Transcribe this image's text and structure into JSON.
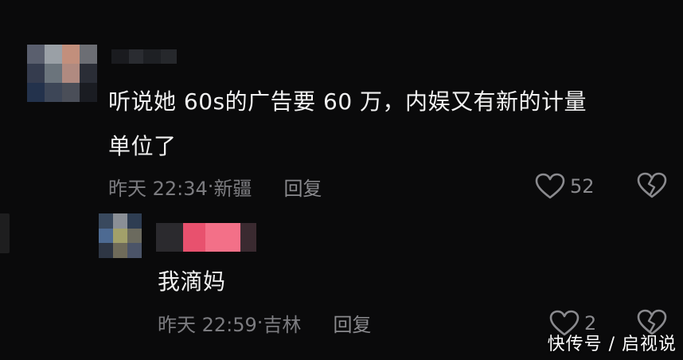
{
  "comments": [
    {
      "text_line1": "听说她 60s的广告要 60 万，内娱又有新的计量",
      "text_line2": "单位了",
      "time": "昨天 22:34",
      "separator": "·",
      "location": "新疆",
      "reply_label": "回复",
      "like_count": "52",
      "avatar_colors": [
        "#5a5f6e",
        "#9aa0a6",
        "#c28f7c",
        "#6c6e74",
        "#353c4e",
        "#6b747c",
        "#b08a80",
        "#2a2d36",
        "#23324c",
        "#3d4657",
        "#4a4e58",
        "#1a1c22"
      ],
      "name_blur_colors": [
        "#1a1b1f",
        "#2a2c31",
        "#1e2024",
        "#26282c"
      ]
    },
    {
      "text": "我滴妈",
      "time": "昨天 22:59",
      "separator": "·",
      "location": "吉林",
      "reply_label": "回复",
      "like_count": "2",
      "avatar_colors": [
        "#39495e",
        "#8a8f96",
        "#2e3d52",
        "#4d6a92",
        "#a2a06a",
        "#6b6a5e",
        "#2e3644",
        "#6f6b5a",
        "#4b5468"
      ],
      "name_blur_colors": [
        "#2b2a2e",
        "#e8516e",
        "#f37088",
        "#3a2a30"
      ]
    }
  ],
  "icons": {
    "like": "heart-outline-icon",
    "dislike": "broken-heart-icon"
  },
  "watermark": "快传号 / 启视说"
}
